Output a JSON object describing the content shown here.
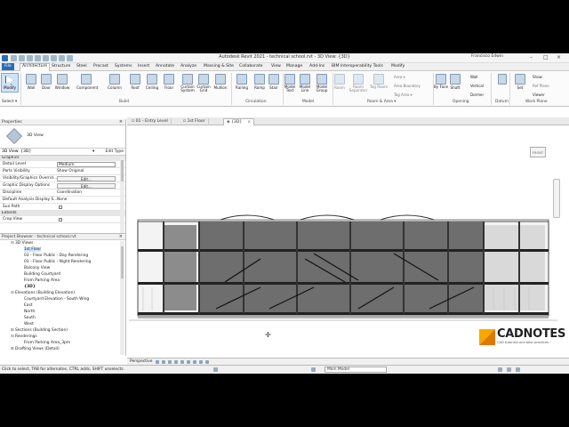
{
  "window": {
    "title": "Autodesk Revit 2021 - technical school.rvt - 3D View: {3D}",
    "user": "Francisco Edwin",
    "minimize": "–",
    "maximize": "□",
    "close": "×"
  },
  "ribbon_tabs": [
    "File",
    "Architecture",
    "Structure",
    "Steel",
    "Precast",
    "Systems",
    "Insert",
    "Annotate",
    "Analyze",
    "Massing & Site",
    "Collaborate",
    "View",
    "Manage",
    "Add-Ins",
    "BIM Interoperability Tools",
    "Modify"
  ],
  "ribbon": {
    "modify": "Modify",
    "select": "Select ▾",
    "build_tools": [
      "Wall",
      "Door",
      "Window",
      "Component",
      "Column",
      "Roof",
      "Ceiling",
      "Floor",
      "Curtain System",
      "Curtain Grid",
      "Mullion"
    ],
    "circulation_tools": [
      "Railing",
      "Ramp",
      "Stair"
    ],
    "model_tools": [
      "Model Text",
      "Model Line",
      "Model Group"
    ],
    "room_tools": [
      "Room",
      "Room Separator",
      "Tag Room"
    ],
    "room_small": [
      "Area ▾",
      "Area Boundary",
      "Tag Area ▾"
    ],
    "opening_tools": [
      "By Face",
      "Shaft"
    ],
    "opening_small": [
      "Wall",
      "Vertical",
      "Dormer"
    ],
    "datum_tools": [
      "Set"
    ],
    "workplane_small": [
      "Show",
      "Ref Plane",
      "Viewer"
    ],
    "panels": {
      "build": "Build",
      "circulation": "Circulation",
      "model": "Model",
      "room": "Room & Area ▾",
      "opening": "Opening",
      "datum": "Datum",
      "workplane": "Work Plane"
    }
  },
  "properties": {
    "title": "Properties",
    "close": "×",
    "type_name": "3D View",
    "instance": "3D View: {3D}",
    "edit_type": "Edit Type",
    "group_graphics": "Graphics",
    "rows": [
      {
        "key": "Detail Level",
        "value": "Medium",
        "kind": "select"
      },
      {
        "key": "Parts Visibility",
        "value": "Show Original",
        "kind": "text"
      },
      {
        "key": "Visibility/Graphics Overrid...",
        "value": "Edit...",
        "kind": "button"
      },
      {
        "key": "Graphic Display Options",
        "value": "Edit...",
        "kind": "button"
      },
      {
        "key": "Discipline",
        "value": "Coordination",
        "kind": "text"
      },
      {
        "key": "Default Analysis Display S...",
        "value": "None",
        "kind": "text"
      },
      {
        "key": "Sun Path",
        "value": "",
        "kind": "check"
      }
    ],
    "group_extents": "Extents",
    "rows2": [
      {
        "key": "Crop View",
        "value": "",
        "kind": "check"
      }
    ],
    "help_link": "Properties help",
    "apply": "Apply"
  },
  "browser": {
    "title": "Project Browser - technical school.rvt",
    "close": "×",
    "items": [
      {
        "level": 1,
        "toggle": "⊟",
        "text": "3D Views"
      },
      {
        "level": 2,
        "toggle": "",
        "text": "1st Floor",
        "selected": true
      },
      {
        "level": 2,
        "toggle": "",
        "text": "03 - Floor Public - Day Rendering"
      },
      {
        "level": 2,
        "toggle": "",
        "text": "03 - Floor Public - Night Rendering"
      },
      {
        "level": 2,
        "toggle": "",
        "text": "Balcony View"
      },
      {
        "level": 2,
        "toggle": "",
        "text": "Building Courtyard"
      },
      {
        "level": 2,
        "toggle": "",
        "text": "From Parking Area"
      },
      {
        "level": 2,
        "toggle": "",
        "text": "{3D}",
        "bold": true
      },
      {
        "level": 1,
        "toggle": "⊟",
        "text": "Elevations (Building Elevation)"
      },
      {
        "level": 2,
        "toggle": "",
        "text": "Courtyard Elevation - South Wing"
      },
      {
        "level": 2,
        "toggle": "",
        "text": "East"
      },
      {
        "level": 2,
        "toggle": "",
        "text": "North"
      },
      {
        "level": 2,
        "toggle": "",
        "text": "South"
      },
      {
        "level": 2,
        "toggle": "",
        "text": "West"
      },
      {
        "level": 1,
        "toggle": "⊞",
        "text": "Sections (Building Section)"
      },
      {
        "level": 1,
        "toggle": "⊟",
        "text": "Renderings"
      },
      {
        "level": 2,
        "toggle": "",
        "text": "From Parking Area_3pm"
      },
      {
        "level": 1,
        "toggle": "⊞",
        "text": "Drafting Views (Detail)"
      }
    ]
  },
  "view_tabs": [
    {
      "text": "01 - Entry Level",
      "active": false
    },
    {
      "text": "1st Floor",
      "active": false
    },
    {
      "text": "{3D}",
      "active": true
    }
  ],
  "viewcube_label": "FRONT",
  "view_control": {
    "label": "Perspective"
  },
  "status": {
    "message": "Click to select, TAB for alternates, CTRL adds, SHIFT unselects.",
    "model": "Main Model"
  },
  "watermark": {
    "name": "CADNOTES",
    "tagline": "CAD tutorials and best practices"
  },
  "colors": {
    "file_tab": "#2a6db5",
    "logo_orange": "#f6a800",
    "selection": "#cfe3f7"
  }
}
